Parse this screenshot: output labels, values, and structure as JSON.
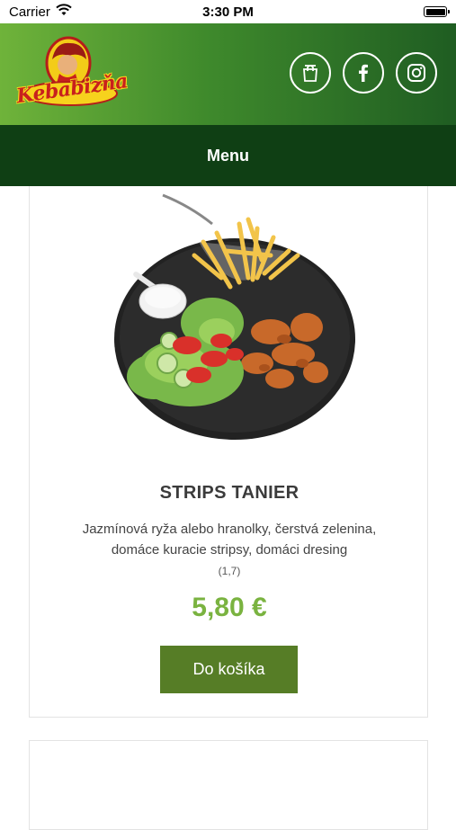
{
  "status_bar": {
    "carrier": "Carrier",
    "time": "3:30 PM"
  },
  "header": {
    "logo_text": "Kebabizňa",
    "social_icons": [
      "shop-icon",
      "facebook-icon",
      "instagram-icon"
    ]
  },
  "nav": {
    "title": "Menu"
  },
  "product": {
    "name": "STRIPS TANIER",
    "description": "Jazmínová ryža alebo hranolky, čerstvá zelenina, domáce kuracie stripsy, domáci dresing",
    "allergens": "(1,7)",
    "price": "5,80 €",
    "add_to_cart_label": "Do košíka"
  },
  "colors": {
    "header_gradient_start": "#6fb33a",
    "header_gradient_end": "#1f5d22",
    "nav_background": "#0f3f14",
    "price": "#7ab340",
    "button": "#567d26"
  }
}
